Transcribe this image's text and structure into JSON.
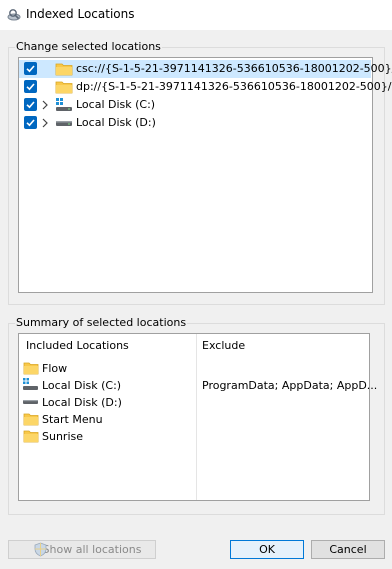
{
  "window": {
    "title": "Indexed Locations"
  },
  "change_group": {
    "label": "Change selected locations",
    "items": [
      {
        "label": "csc://{S-1-5-21-3971141326-536610536-18001202-500}/",
        "icon": "folder-icon",
        "checked": true,
        "expandable": false,
        "selected": true
      },
      {
        "label": "dp://{S-1-5-21-3971141326-536610536-18001202-500}/",
        "icon": "folder-icon",
        "checked": true,
        "expandable": false,
        "selected": false
      },
      {
        "label": "Local Disk (C:)",
        "icon": "windows-drive-icon",
        "checked": true,
        "expandable": true,
        "selected": false
      },
      {
        "label": "Local Disk (D:)",
        "icon": "drive-icon",
        "checked": true,
        "expandable": true,
        "selected": false
      }
    ]
  },
  "summary_group": {
    "label": "Summary of selected locations",
    "col_included": "Included Locations",
    "col_exclude": "Exclude",
    "rows": [
      {
        "label": "Flow",
        "icon": "folder-icon",
        "exclude": ""
      },
      {
        "label": "Local Disk (C:)",
        "icon": "windows-drive-icon",
        "exclude": "ProgramData; AppData; AppD..."
      },
      {
        "label": "Local Disk (D:)",
        "icon": "drive-icon",
        "exclude": ""
      },
      {
        "label": "Start Menu",
        "icon": "folder-icon",
        "exclude": ""
      },
      {
        "label": "Sunrise",
        "icon": "folder-icon",
        "exclude": ""
      }
    ]
  },
  "buttons": {
    "show_all": "Show all locations",
    "ok": "OK",
    "cancel": "Cancel"
  },
  "colors": {
    "accent": "#0067c0",
    "selection": "#cde8ff",
    "folder": "#f8c84a"
  }
}
